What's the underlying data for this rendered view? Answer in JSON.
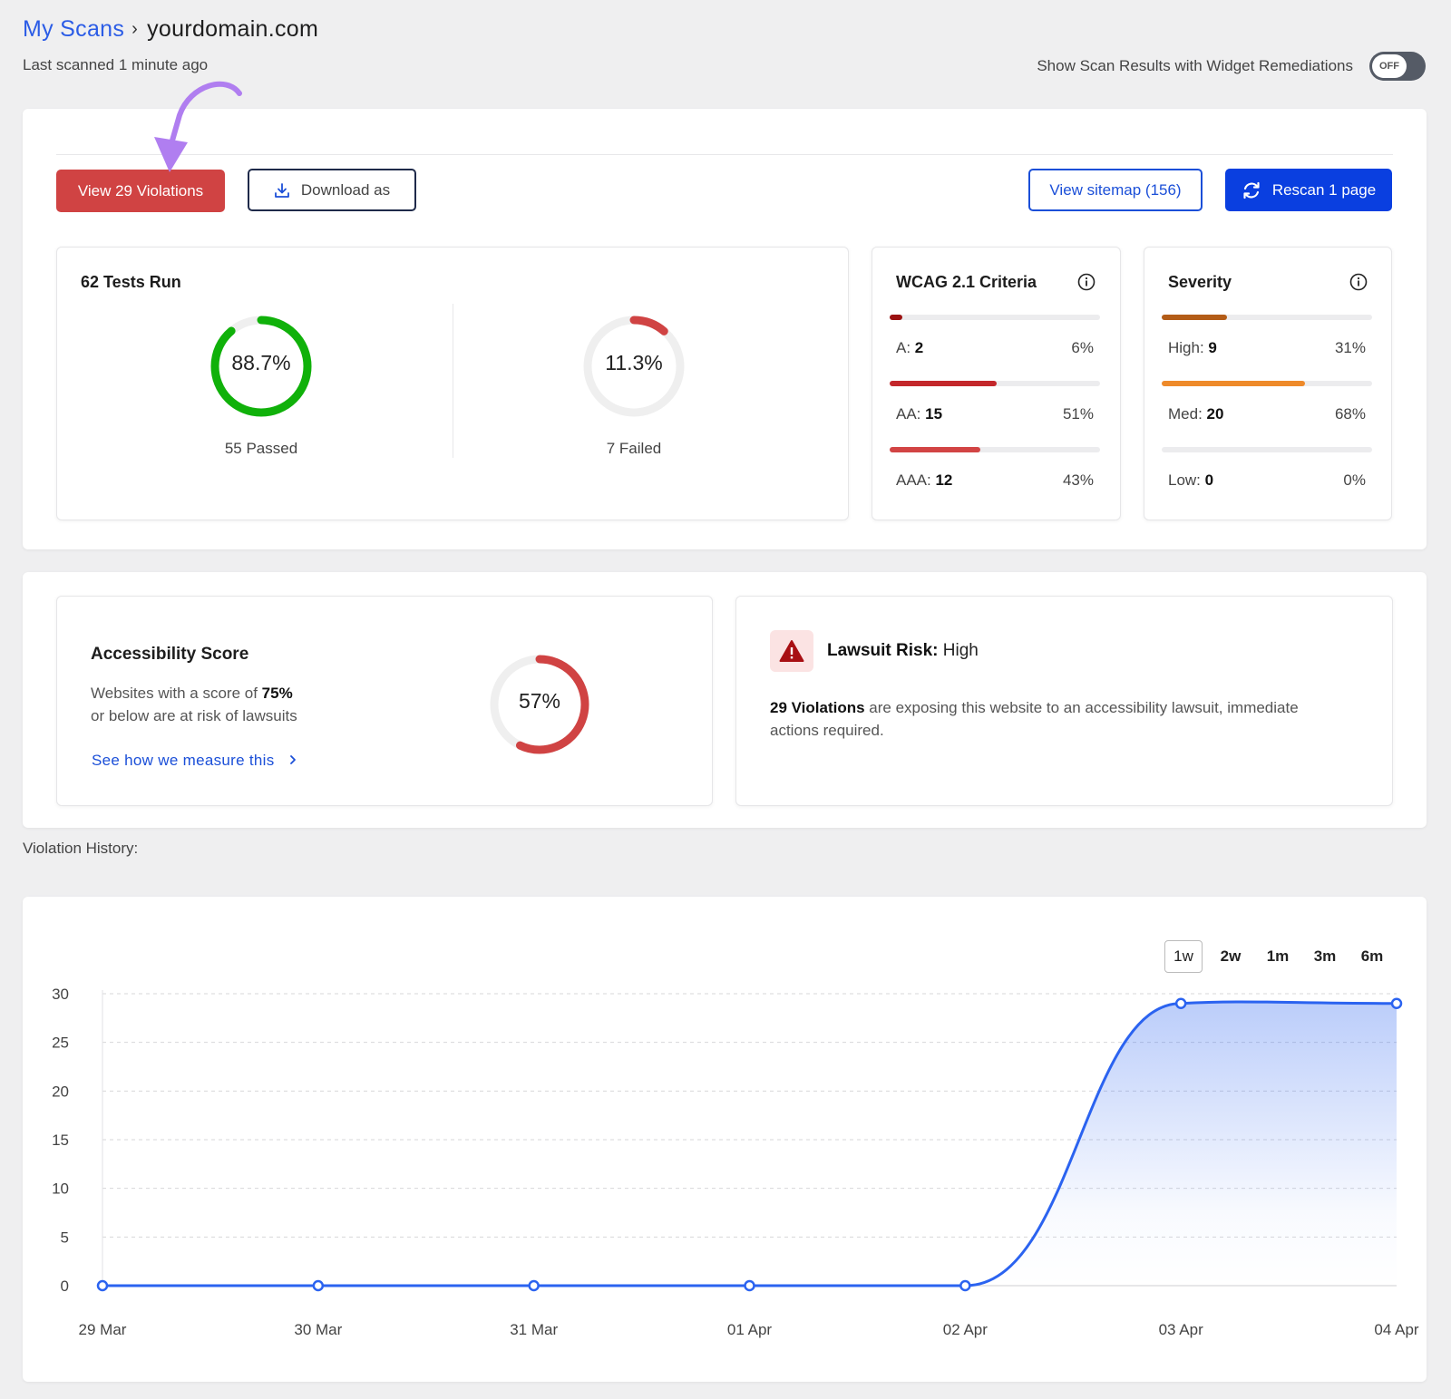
{
  "header": {
    "breadcrumb_link": "My Scans",
    "breadcrumb_sep": "›",
    "domain": "yourdomain.com",
    "last_scanned": "Last scanned 1 minute ago",
    "toggle_label": "Show Scan Results with Widget Remediations",
    "toggle_state": "OFF"
  },
  "actions": {
    "view_violations": "View 29 Violations",
    "download": "Download as",
    "sitemap": "View sitemap (156)",
    "rescan": "Rescan 1 page"
  },
  "tests": {
    "title": "62 Tests Run",
    "passed_pct": 88.7,
    "passed_pct_label": "88.7%",
    "passed_caption": "55 Passed",
    "failed_pct": 11.3,
    "failed_pct_label": "11.3%",
    "failed_caption": "7 Failed"
  },
  "wcag": {
    "title": "WCAG 2.1 Criteria",
    "items": [
      {
        "label": "A:",
        "count": "2",
        "pct_label": "6%",
        "pct": 6,
        "color": "#9b1111"
      },
      {
        "label": "AA:",
        "count": "15",
        "pct_label": "51%",
        "pct": 51,
        "color": "#c3272b"
      },
      {
        "label": "AAA:",
        "count": "12",
        "pct_label": "43%",
        "pct": 43,
        "color": "#d24444"
      }
    ]
  },
  "severity": {
    "title": "Severity",
    "items": [
      {
        "label": "High:",
        "count": "9",
        "pct_label": "31%",
        "pct": 31,
        "color": "#b35c17"
      },
      {
        "label": "Med:",
        "count": "20",
        "pct_label": "68%",
        "pct": 68,
        "color": "#ee8a2a"
      },
      {
        "label": "Low:",
        "count": "0",
        "pct_label": "0%",
        "pct": 0,
        "color": "#e0a040"
      }
    ]
  },
  "score": {
    "title": "Accessibility Score",
    "desc_pre": "Websites with a score of ",
    "desc_bold": "75%",
    "desc_post": "or below are at risk of lawsuits",
    "link": "See how we measure this",
    "value": 57,
    "value_label": "57%"
  },
  "risk": {
    "title_bold": "Lawsuit Risk:",
    "title_value": "High",
    "desc_bold": "29 Violations",
    "desc_rest": " are exposing this website to an accessibility lawsuit, immediate actions required."
  },
  "history": {
    "label": "Violation History:",
    "ranges": [
      "1w",
      "2w",
      "1m",
      "3m",
      "6m"
    ],
    "active_range": "1w"
  },
  "colors": {
    "accent_blue": "#2b63f0",
    "danger_red": "#d04343",
    "success_green": "#10b10a"
  },
  "chart_data": {
    "type": "area",
    "x": [
      "29 Mar",
      "30 Mar",
      "31 Mar",
      "01 Apr",
      "02 Apr",
      "03 Apr",
      "04 Apr"
    ],
    "values": [
      0,
      0,
      0,
      0,
      0,
      29,
      29
    ],
    "yticks": [
      0,
      5,
      10,
      15,
      20,
      25,
      30
    ],
    "ylim": [
      0,
      30
    ],
    "grid": true,
    "title": "",
    "xlabel": "",
    "ylabel": ""
  }
}
